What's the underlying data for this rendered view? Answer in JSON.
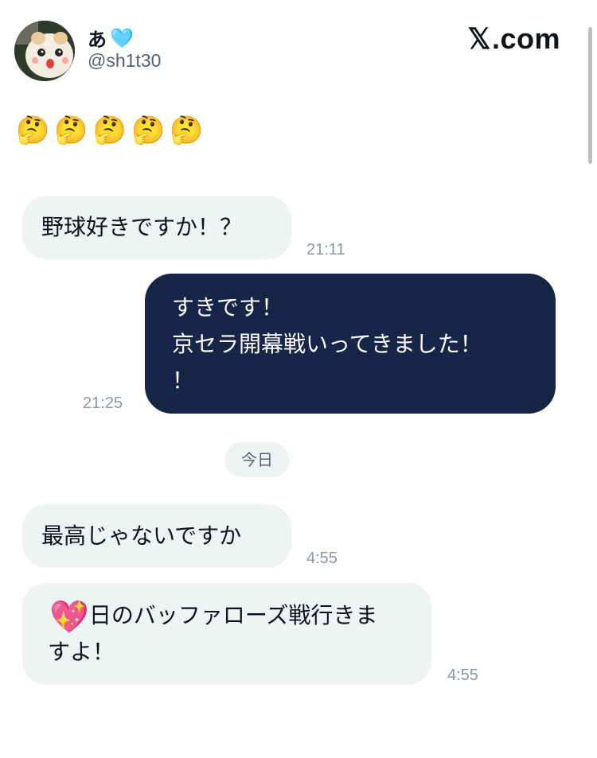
{
  "header": {
    "display_name": "あ",
    "name_emoji": "🩵",
    "handle": "@sh1t30",
    "brand_x": "𝕏",
    "brand_suffix": ".com"
  },
  "tweet_emojis": [
    "🤔",
    "🤔",
    "🤔",
    "🤔",
    "🤔"
  ],
  "messages": {
    "m1": {
      "text": "野球好きですか！？",
      "time": "21:11"
    },
    "m2": {
      "line1": "すきです！",
      "line2": "京セラ開幕戦いってきました！",
      "line3": "！",
      "time": "21:25"
    },
    "divider": "今日",
    "m3": {
      "text": "最高じゃないですか",
      "time": "4:55"
    },
    "m4": {
      "emoji": "💖",
      "line1": "日のバッファローズ戦行きま",
      "line2": "すよ！",
      "time": "4:55"
    }
  }
}
